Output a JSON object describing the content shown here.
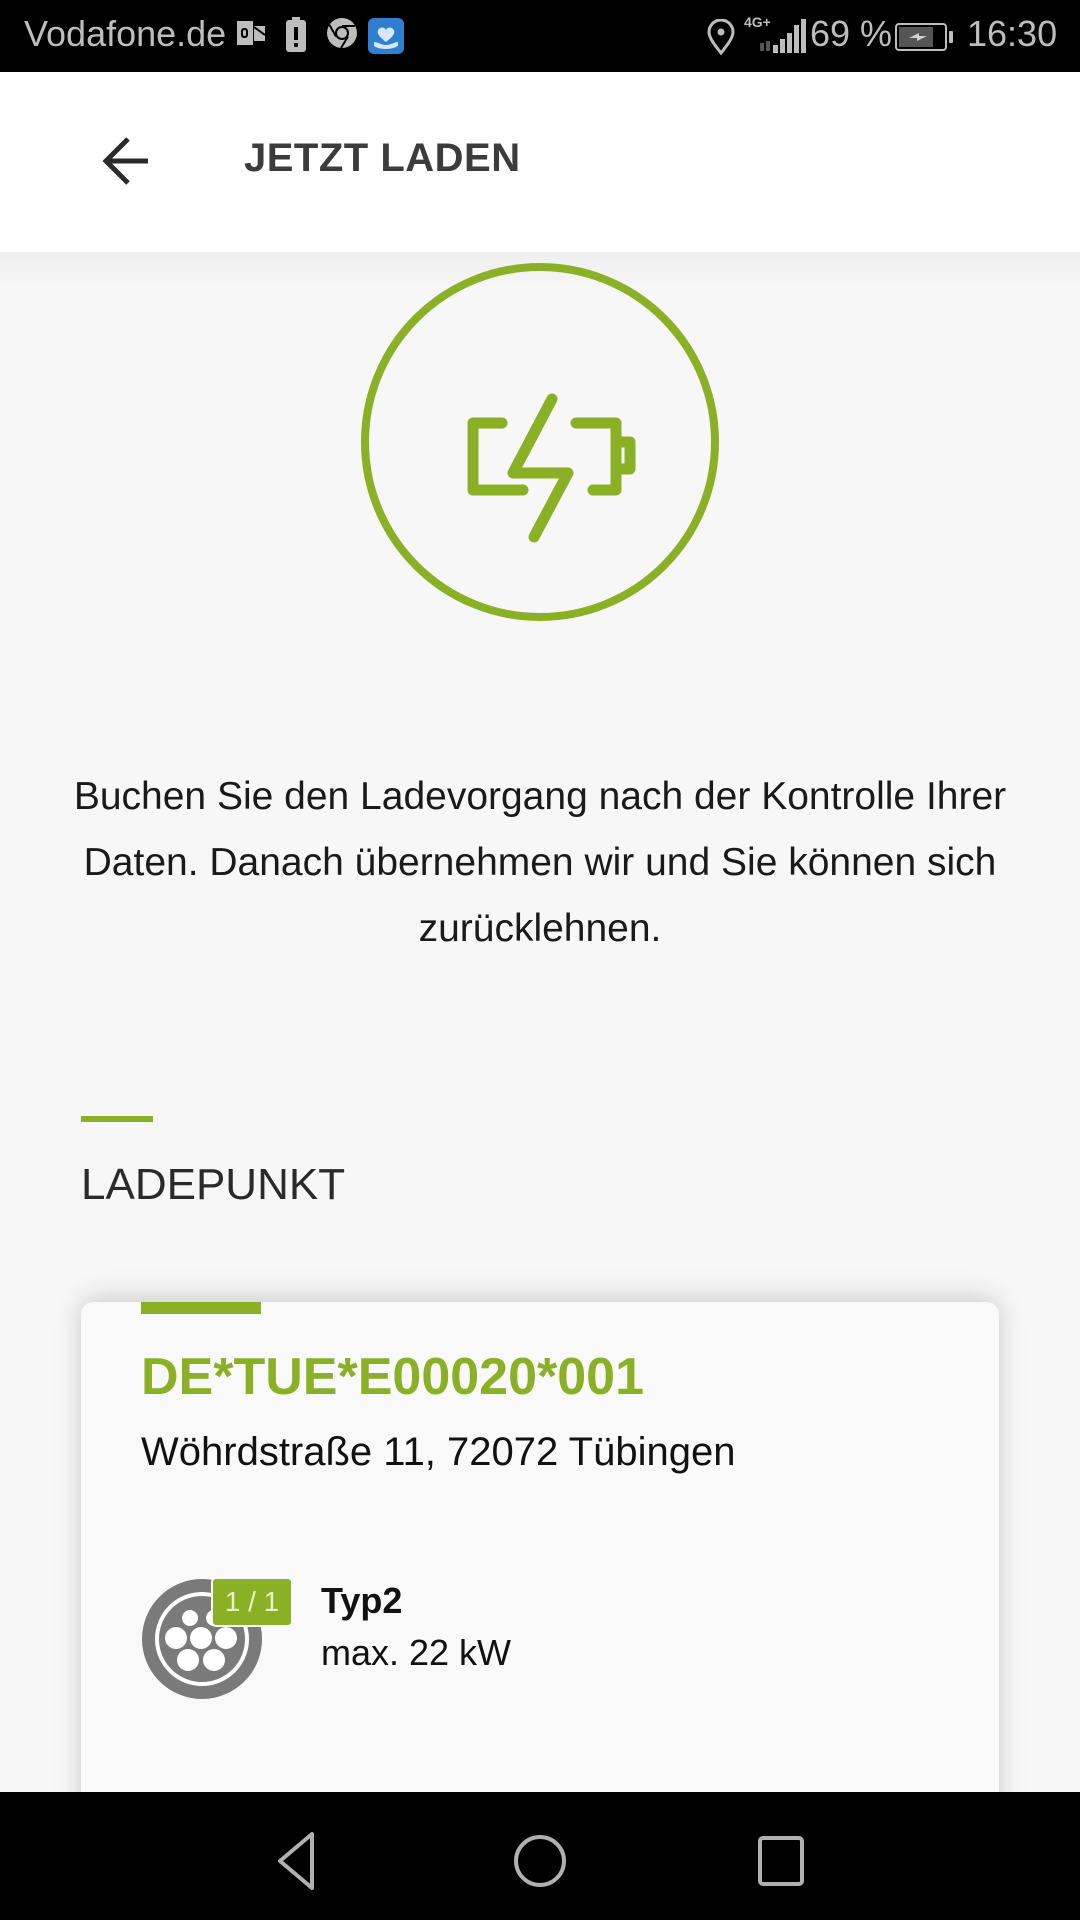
{
  "status_bar": {
    "carrier": "Vodafone.de",
    "notification_icons": [
      "outlook-icon",
      "battery-alert-icon",
      "chrome-icon",
      "health-app-icon"
    ],
    "network": "4G+",
    "battery_percent": "69 %",
    "time": "16:30"
  },
  "app_bar": {
    "title": "JETZT LADEN",
    "back_icon": "arrow-left-icon"
  },
  "hero": {
    "icon": "battery-charging-icon",
    "accent_color": "#8ab026"
  },
  "description": "Buchen Sie den Ladevorgang nach der Kontrolle Ihrer Daten. Danach übernehmen wir und Sie können sich zurücklehnen.",
  "section": {
    "title": "LADEPUNKT"
  },
  "charge_point": {
    "id": "DE*TUE*E00020*001",
    "address": "Wöhrdstraße 11, 72072 Tübingen",
    "connector": {
      "icon": "type2-plug-icon",
      "badge": "1 / 1",
      "type": "Typ2",
      "power": "max. 22 kW"
    }
  },
  "nav_bar": {
    "buttons": [
      "back",
      "home",
      "recents"
    ]
  }
}
